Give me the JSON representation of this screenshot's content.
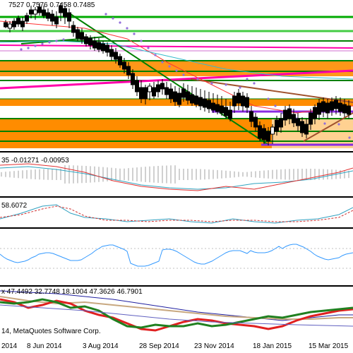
{
  "main_chart": {
    "ohlc_label": "7527 0.7576 0.7458 0.7485",
    "colors": {
      "orange_zone": "#FF8C00",
      "green_line": "#008000",
      "magenta_line": "#FF00AA",
      "purple_line": "#8A2BE2",
      "brown_line": "#A0522D",
      "sar_dots": "#9370DB",
      "ma_red": "#FF3333",
      "ma_cyan": "#33BBCC",
      "bull_candle": "#FFFFFF",
      "bear_candle": "#000000"
    }
  },
  "macd_pane": {
    "label": "35 -0.01271 -0.00953"
  },
  "stoch_pane": {
    "label": "58.6072"
  },
  "rsi_pane": {
    "label": ""
  },
  "dmi_pane": {
    "label": "x 47.4492 32.7748 18.1004 47.3626 46.7901",
    "copyright": "14, MetaQuotes Software Corp."
  },
  "x_axis": {
    "ticks": [
      "2014",
      "8 Jun 2014",
      "3 Aug 2014",
      "28 Sep 2014",
      "23 Nov 2014",
      "18 Jan 2015",
      "15 Mar 2015"
    ]
  }
}
